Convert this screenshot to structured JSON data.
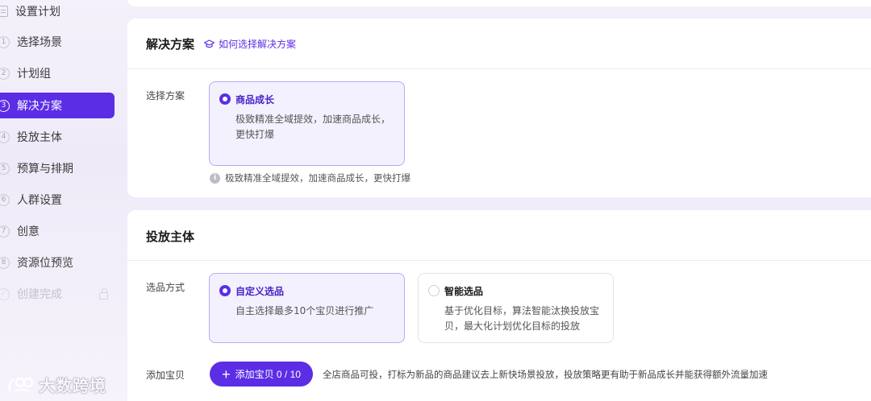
{
  "sidebar": {
    "header": "设置计划",
    "items": [
      {
        "num": "1",
        "label": "选择场景"
      },
      {
        "num": "2",
        "label": "计划组"
      },
      {
        "num": "3",
        "label": "解决方案"
      },
      {
        "num": "4",
        "label": "投放主体"
      },
      {
        "num": "5",
        "label": "预算与排期"
      },
      {
        "num": "6",
        "label": "人群设置"
      },
      {
        "num": "7",
        "label": "创意"
      },
      {
        "num": "8",
        "label": "资源位预览"
      }
    ],
    "final": {
      "label": "创建完成",
      "icon": "lock-icon"
    },
    "active_index": 2
  },
  "watermark": "大数跨境",
  "solution": {
    "title": "解决方案",
    "help_link": "如何选择解决方案",
    "field_label": "选择方案",
    "option": {
      "title": "商品成长",
      "desc": "极致精准全域提效，加速商品成长，更快打爆"
    },
    "hint": "极致精准全域提效，加速商品成长，更快打爆"
  },
  "subject": {
    "title": "投放主体",
    "field_label": "选品方式",
    "options": [
      {
        "title": "自定义选品",
        "desc": "自主选择最多10个宝贝进行推广",
        "selected": true
      },
      {
        "title": "智能选品",
        "desc": "基于优化目标，算法智能汰换投放宝贝，最大化计划优化目标的投放",
        "selected": false
      }
    ],
    "add_label": "添加宝贝",
    "add_button": "添加宝贝 0 / 10",
    "add_note": "全店商品可投，打标为新品的商品建议去上新快场景投放，投放策略更有助于新品成长并能获得额外流量加速"
  },
  "colors": {
    "accent": "#5b2ee6",
    "selected_bg": "#f3f1fd"
  }
}
